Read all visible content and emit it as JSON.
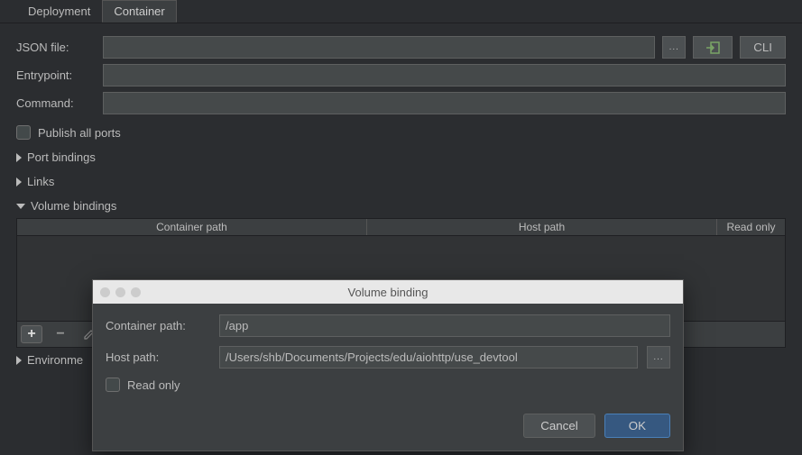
{
  "tabs": {
    "deployment": "Deployment",
    "container": "Container"
  },
  "form": {
    "json_file_label": "JSON file:",
    "json_file_value": "",
    "entrypoint_label": "Entrypoint:",
    "entrypoint_value": "",
    "command_label": "Command:",
    "command_value": "",
    "cli_label": "CLI",
    "publish_all_ports": "Publish all ports"
  },
  "sections": {
    "port_bindings": "Port bindings",
    "links": "Links",
    "volume_bindings": "Volume bindings",
    "environment": "Environme"
  },
  "volume_table": {
    "col_container_path": "Container path",
    "col_host_path": "Host path",
    "col_read_only": "Read only"
  },
  "toolbar_icons": {
    "plus": "+",
    "minus": "−",
    "edit": "✎"
  },
  "dialog": {
    "title": "Volume binding",
    "container_path_label": "Container path:",
    "container_path_value": "/app",
    "host_path_label": "Host path:",
    "host_path_value": "/Users/shb/Documents/Projects/edu/aiohttp/use_devtool",
    "read_only_label": "Read only",
    "cancel": "Cancel",
    "ok": "OK"
  },
  "browse_label": "..."
}
